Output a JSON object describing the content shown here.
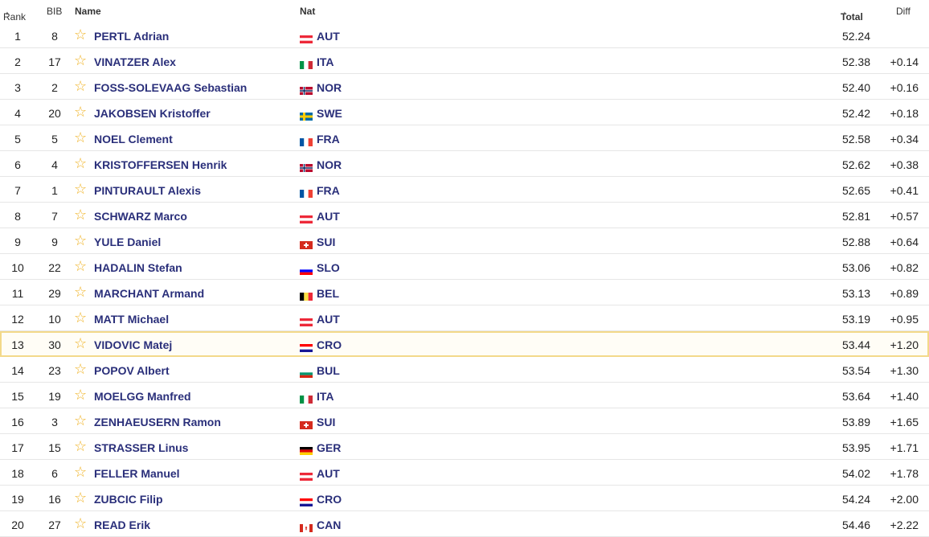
{
  "headers": {
    "rank": "Rank",
    "bib": "BIB",
    "name": "Name",
    "nat": "Nat",
    "total": "Total",
    "diff": "Diff"
  },
  "rows": [
    {
      "rank": "1",
      "bib": "8",
      "name": "PERTL Adrian",
      "nat": "AUT",
      "total": "52.24",
      "diff": ""
    },
    {
      "rank": "2",
      "bib": "17",
      "name": "VINATZER Alex",
      "nat": "ITA",
      "total": "52.38",
      "diff": "+0.14"
    },
    {
      "rank": "3",
      "bib": "2",
      "name": "FOSS-SOLEVAAG Sebastian",
      "nat": "NOR",
      "total": "52.40",
      "diff": "+0.16"
    },
    {
      "rank": "4",
      "bib": "20",
      "name": "JAKOBSEN Kristoffer",
      "nat": "SWE",
      "total": "52.42",
      "diff": "+0.18"
    },
    {
      "rank": "5",
      "bib": "5",
      "name": "NOEL Clement",
      "nat": "FRA",
      "total": "52.58",
      "diff": "+0.34"
    },
    {
      "rank": "6",
      "bib": "4",
      "name": "KRISTOFFERSEN Henrik",
      "nat": "NOR",
      "total": "52.62",
      "diff": "+0.38"
    },
    {
      "rank": "7",
      "bib": "1",
      "name": "PINTURAULT Alexis",
      "nat": "FRA",
      "total": "52.65",
      "diff": "+0.41"
    },
    {
      "rank": "8",
      "bib": "7",
      "name": "SCHWARZ Marco",
      "nat": "AUT",
      "total": "52.81",
      "diff": "+0.57"
    },
    {
      "rank": "9",
      "bib": "9",
      "name": "YULE Daniel",
      "nat": "SUI",
      "total": "52.88",
      "diff": "+0.64"
    },
    {
      "rank": "10",
      "bib": "22",
      "name": "HADALIN Stefan",
      "nat": "SLO",
      "total": "53.06",
      "diff": "+0.82"
    },
    {
      "rank": "11",
      "bib": "29",
      "name": "MARCHANT Armand",
      "nat": "BEL",
      "total": "53.13",
      "diff": "+0.89"
    },
    {
      "rank": "12",
      "bib": "10",
      "name": "MATT Michael",
      "nat": "AUT",
      "total": "53.19",
      "diff": "+0.95"
    },
    {
      "rank": "13",
      "bib": "30",
      "name": "VIDOVIC Matej",
      "nat": "CRO",
      "total": "53.44",
      "diff": "+1.20",
      "highlight": true
    },
    {
      "rank": "14",
      "bib": "23",
      "name": "POPOV Albert",
      "nat": "BUL",
      "total": "53.54",
      "diff": "+1.30"
    },
    {
      "rank": "15",
      "bib": "19",
      "name": "MOELGG Manfred",
      "nat": "ITA",
      "total": "53.64",
      "diff": "+1.40"
    },
    {
      "rank": "16",
      "bib": "3",
      "name": "ZENHAEUSERN Ramon",
      "nat": "SUI",
      "total": "53.89",
      "diff": "+1.65"
    },
    {
      "rank": "17",
      "bib": "15",
      "name": "STRASSER Linus",
      "nat": "GER",
      "total": "53.95",
      "diff": "+1.71"
    },
    {
      "rank": "18",
      "bib": "6",
      "name": "FELLER Manuel",
      "nat": "AUT",
      "total": "54.02",
      "diff": "+1.78"
    },
    {
      "rank": "19",
      "bib": "16",
      "name": "ZUBCIC Filip",
      "nat": "CRO",
      "total": "54.24",
      "diff": "+2.00"
    },
    {
      "rank": "20",
      "bib": "27",
      "name": "READ Erik",
      "nat": "CAN",
      "total": "54.46",
      "diff": "+2.22"
    }
  ],
  "flags": {
    "AUT": {
      "type": "h",
      "colors": [
        "#ed2939",
        "#ffffff",
        "#ed2939"
      ]
    },
    "ITA": {
      "type": "v",
      "colors": [
        "#009246",
        "#ffffff",
        "#ce2b37"
      ]
    },
    "NOR": {
      "type": "cross",
      "colors": [
        "#ba0c2f",
        "#ffffff",
        "#00205b"
      ]
    },
    "SWE": {
      "type": "cross",
      "colors": [
        "#006aa7",
        "#fecc00",
        "#fecc00"
      ]
    },
    "FRA": {
      "type": "v",
      "colors": [
        "#0055a4",
        "#ffffff",
        "#ef4135"
      ]
    },
    "SUI": {
      "type": "swiss",
      "colors": [
        "#d52b1e",
        "#ffffff"
      ]
    },
    "SLO": {
      "type": "h",
      "colors": [
        "#ffffff",
        "#0000ff",
        "#ff0000"
      ]
    },
    "BEL": {
      "type": "v",
      "colors": [
        "#000000",
        "#fae042",
        "#ed2939"
      ]
    },
    "CRO": {
      "type": "h",
      "colors": [
        "#ff0000",
        "#ffffff",
        "#171796"
      ]
    },
    "BUL": {
      "type": "h",
      "colors": [
        "#ffffff",
        "#00966e",
        "#d62612"
      ]
    },
    "GER": {
      "type": "h",
      "colors": [
        "#000000",
        "#dd0000",
        "#ffce00"
      ]
    },
    "CAN": {
      "type": "can",
      "colors": [
        "#d52b1e",
        "#ffffff"
      ]
    }
  }
}
